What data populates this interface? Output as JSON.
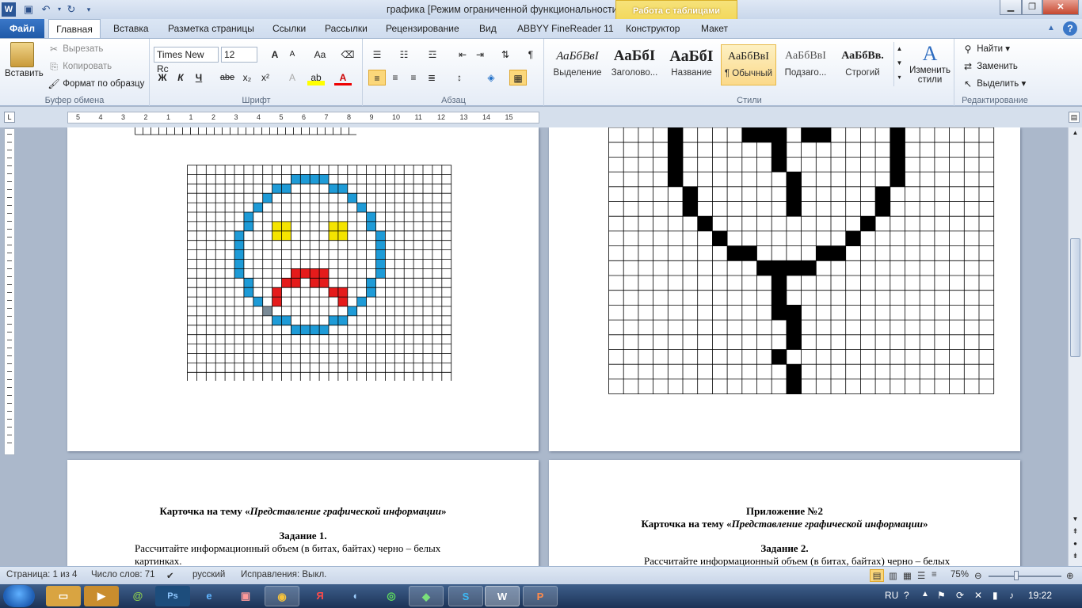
{
  "window": {
    "title": "графика [Режим ограниченной функциональности] - Microsoft Word",
    "context_tab_group": "Работа с таблицами",
    "app_icon": "W",
    "quick_access": [
      "save-icon",
      "undo-icon",
      "redo-icon",
      "customize-icon"
    ],
    "controls": [
      "minimize-icon",
      "restore-icon",
      "close-icon"
    ]
  },
  "tabs": [
    "Файл",
    "Главная",
    "Вставка",
    "Разметка страницы",
    "Ссылки",
    "Рассылки",
    "Рецензирование",
    "Вид",
    "ABBYY FineReader 11",
    "Конструктор",
    "Макет"
  ],
  "ribbon": {
    "clipboard": {
      "label": "Буфер обмена",
      "paste": "Вставить",
      "cut": "Вырезать",
      "copy": "Копировать",
      "format_painter": "Формат по образцу"
    },
    "font": {
      "label": "Шрифт",
      "font_name": "Times New Rc",
      "font_size": "12",
      "grow": "A",
      "shrink": "A",
      "case": "Aa",
      "bold": "Ж",
      "italic": "К",
      "underline": "Ч",
      "strike": "abe",
      "subscript": "x₂",
      "superscript": "x²",
      "font_color": "A"
    },
    "paragraph": {
      "label": "Абзац"
    },
    "styles": {
      "label": "Стили",
      "items": [
        {
          "sample": "АаБбВвІ",
          "name": "Выделение"
        },
        {
          "sample": "АаБбI",
          "name": "Заголово..."
        },
        {
          "sample": "АаБбI",
          "name": "Название"
        },
        {
          "sample": "АаБбВвІ",
          "name": "¶ Обычный"
        },
        {
          "sample": "АаБбВвІ",
          "name": "Подзаго..."
        },
        {
          "sample": "АаБбВв.",
          "name": "Строгий"
        }
      ],
      "change": "Изменить стили"
    },
    "editing": {
      "label": "Редактирование",
      "find": "Найти",
      "replace": "Заменить",
      "select": "Выделить"
    }
  },
  "ruler": {
    "numbers": [
      "5",
      "4",
      "3",
      "2",
      "1",
      "1",
      "2",
      "3",
      "4",
      "5",
      "6",
      "7",
      "8",
      "9",
      "10",
      "11",
      "12",
      "13",
      "14",
      "15"
    ]
  },
  "pages": {
    "left_bottom": {
      "card_title_prefix": "Карточка  на тему «",
      "card_title_italic": "Представление графической  информации",
      "card_title_suffix": "»",
      "task": "Задание 1.",
      "body_line1": "Рассчитайте информационный объем (в битах, байтах) черно – белых",
      "body_line2": "картинках."
    },
    "right_bottom": {
      "appendix": "Приложение №2",
      "card_title_prefix": "Карточка  на тему «",
      "card_title_italic": "Представление графической  информации",
      "card_title_suffix": "»",
      "task": "Задание 2.",
      "body_line1": "Рассчитайте информационный объем (в битах, байтах) черно – белых"
    }
  },
  "colors": {
    "blue": "#1e9bd7",
    "yellow": "#f5e400",
    "red": "#e51b1b",
    "black": "#000000",
    "gray": "#7a8a96"
  },
  "status": {
    "page": "Страница: 1 из 4",
    "words": "Число слов: 71",
    "language": "русский",
    "track": "Исправления: Выкл.",
    "zoom": "75%"
  },
  "taskbar": {
    "apps": [
      "explorer-icon",
      "media-icon",
      "chrome-like-icon",
      "photoshop-icon",
      "ie-icon",
      "paint-icon",
      "chrome-icon",
      "yandex-icon",
      "speaker-icon",
      "green-icon",
      "media-player-icon",
      "skype-icon",
      "word-icon",
      "powerpoint-icon"
    ],
    "lang": "RU",
    "clock": "19:22"
  }
}
